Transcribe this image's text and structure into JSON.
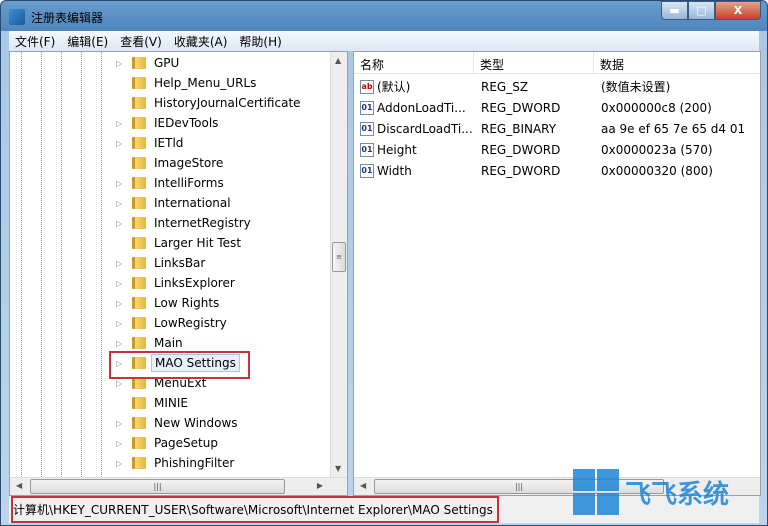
{
  "window": {
    "title": "注册表编辑器",
    "minimize": "▬",
    "maximize": "□",
    "close": "X"
  },
  "menu": [
    "文件(F)",
    "编辑(E)",
    "查看(V)",
    "收藏夹(A)",
    "帮助(H)"
  ],
  "tree": [
    {
      "label": "GPU",
      "expandable": true
    },
    {
      "label": "Help_Menu_URLs",
      "expandable": false
    },
    {
      "label": "HistoryJournalCertificate",
      "expandable": false
    },
    {
      "label": "IEDevTools",
      "expandable": true
    },
    {
      "label": "IETld",
      "expandable": true
    },
    {
      "label": "ImageStore",
      "expandable": false
    },
    {
      "label": "IntelliForms",
      "expandable": true
    },
    {
      "label": "International",
      "expandable": true
    },
    {
      "label": "InternetRegistry",
      "expandable": true
    },
    {
      "label": "Larger Hit Test",
      "expandable": false
    },
    {
      "label": "LinksBar",
      "expandable": true
    },
    {
      "label": "LinksExplorer",
      "expandable": true
    },
    {
      "label": "Low Rights",
      "expandable": true
    },
    {
      "label": "LowRegistry",
      "expandable": true
    },
    {
      "label": "Main",
      "expandable": true
    },
    {
      "label": "MAO Settings",
      "expandable": true,
      "selected": true
    },
    {
      "label": "MenuExt",
      "expandable": true
    },
    {
      "label": "MINIE",
      "expandable": false
    },
    {
      "label": "New Windows",
      "expandable": true
    },
    {
      "label": "PageSetup",
      "expandable": true
    },
    {
      "label": "PhishingFilter",
      "expandable": true
    }
  ],
  "values": {
    "headers": [
      "名称",
      "类型",
      "数据"
    ],
    "rows": [
      {
        "icon": "ab",
        "name": "(默认)",
        "type": "REG_SZ",
        "data": "(数值未设置)"
      },
      {
        "icon": "binary",
        "name": "AddonLoadTi...",
        "type": "REG_DWORD",
        "data": "0x000000c8 (200)"
      },
      {
        "icon": "binary",
        "name": "DiscardLoadTi...",
        "type": "REG_BINARY",
        "data": "aa 9e ef 65 7e 65 d4 01"
      },
      {
        "icon": "binary",
        "name": "Height",
        "type": "REG_DWORD",
        "data": "0x0000023a (570)"
      },
      {
        "icon": "binary",
        "name": "Width",
        "type": "REG_DWORD",
        "data": "0x00000320 (800)"
      }
    ]
  },
  "status": {
    "path": "计算机\\HKEY_CURRENT_USER\\Software\\Microsoft\\Internet Explorer\\MAO Settings"
  },
  "watermark": {
    "text": "飞飞系统"
  },
  "colors": {
    "highlight": "#c8323c",
    "accent": "#1f86d6"
  }
}
